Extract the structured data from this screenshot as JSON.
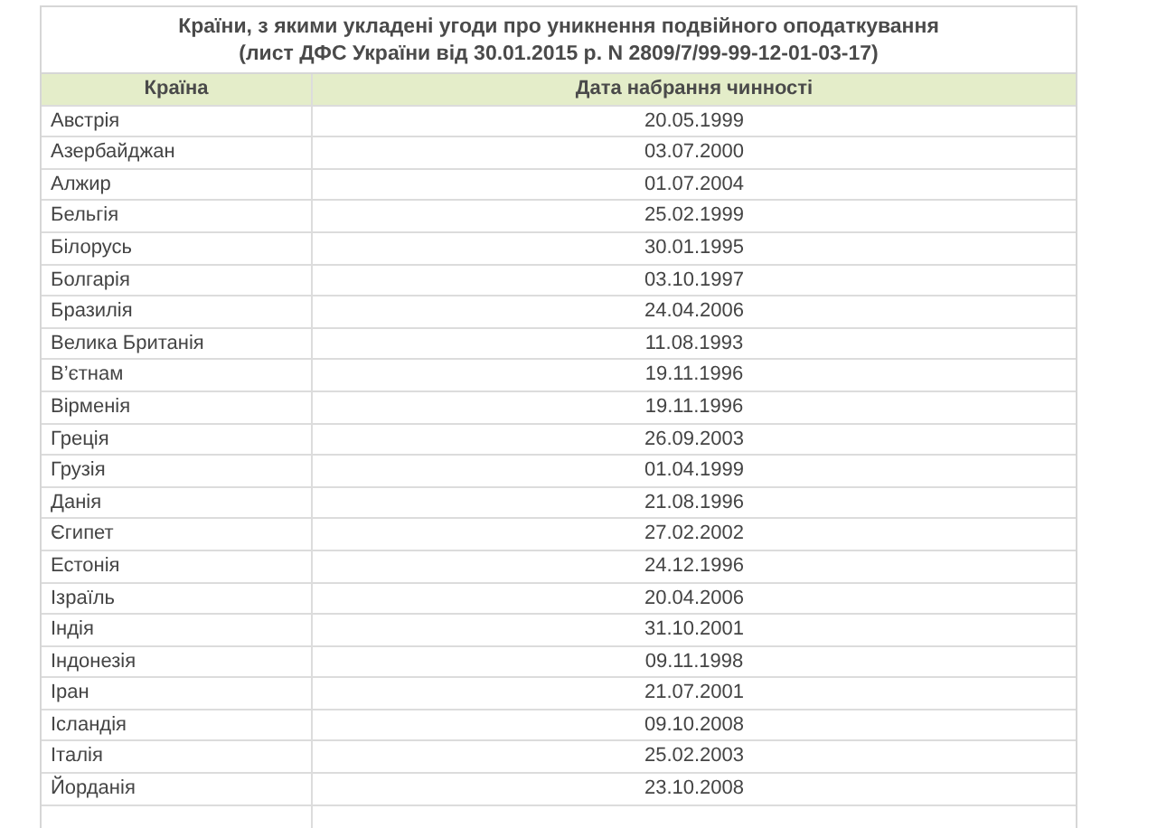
{
  "table": {
    "title": [
      "Країни, з якими укладені угоди про уникнення подвійного оподаткування",
      "(лист ДФС України від 30.01.2015 р. N 2809/7/99-99-12-01-03-17)"
    ],
    "columns": [
      "Країна",
      "Дата набрання чинності"
    ],
    "rows": [
      [
        "Австрія",
        "20.05.1999"
      ],
      [
        "Азербайджан",
        "03.07.2000"
      ],
      [
        "Алжир",
        "01.07.2004"
      ],
      [
        "Бельгія",
        "25.02.1999"
      ],
      [
        "Білорусь",
        "30.01.1995"
      ],
      [
        "Болгарія",
        "03.10.1997"
      ],
      [
        "Бразилія",
        "24.04.2006"
      ],
      [
        "Велика Британія",
        "11.08.1993"
      ],
      [
        "В’єтнам",
        "19.11.1996"
      ],
      [
        "Вірменія",
        "19.11.1996"
      ],
      [
        "Греція",
        "26.09.2003"
      ],
      [
        "Грузія",
        "01.04.1999"
      ],
      [
        "Данія",
        "21.08.1996"
      ],
      [
        "Єгипет",
        "27.02.2002"
      ],
      [
        "Естонія",
        "24.12.1996"
      ],
      [
        "Ізраїль",
        "20.04.2006"
      ],
      [
        "Індія",
        "31.10.2001"
      ],
      [
        "Індонезія",
        "09.11.1998"
      ],
      [
        "Іран",
        "21.07.2001"
      ],
      [
        "Ісландія",
        "09.10.2008"
      ],
      [
        "Італія",
        "25.02.2003"
      ],
      [
        "Йорданія",
        "23.10.2008"
      ]
    ]
  }
}
